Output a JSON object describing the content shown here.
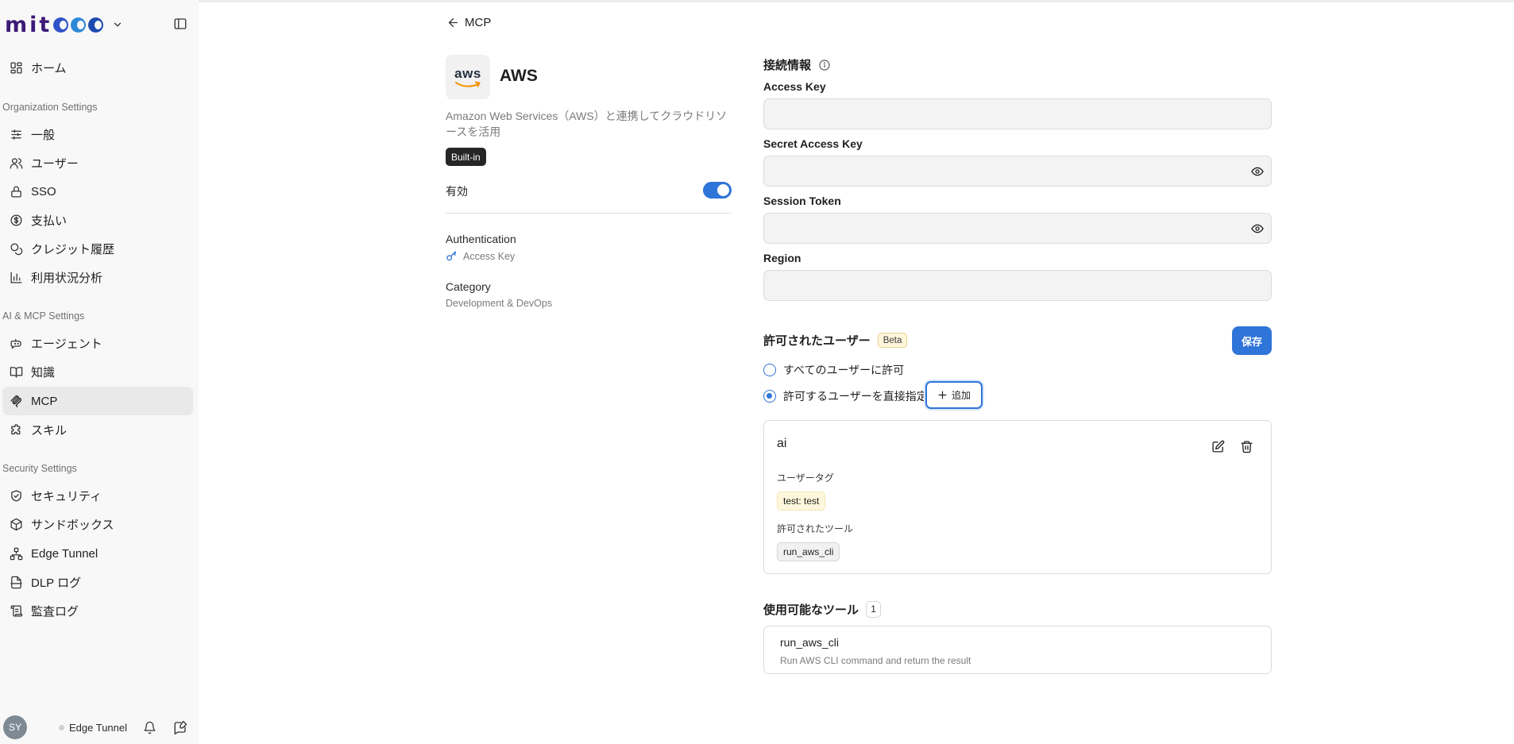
{
  "sidebar": {
    "logo_text": "mit",
    "sections": {
      "organization": "Organization Settings",
      "ai_mcp": "AI & MCP Settings",
      "security": "Security Settings"
    },
    "items": {
      "home": "ホーム",
      "general": "一般",
      "users": "ユーザー",
      "sso": "SSO",
      "payment": "支払い",
      "credit_history": "クレジット履歴",
      "usage_analysis": "利用状況分析",
      "agent": "エージェント",
      "knowledge": "知識",
      "mcp": "MCP",
      "skill": "スキル",
      "security": "セキュリティ",
      "sandbox": "サンドボックス",
      "edge_tunnel": "Edge Tunnel",
      "dlp_log": "DLP ログ",
      "audit_log": "監査ログ"
    },
    "active_item": "mcp",
    "footer": {
      "avatar_initials": "SY",
      "edge_tunnel_status": "Edge Tunnel"
    }
  },
  "header": {
    "back_label": "MCP"
  },
  "app": {
    "logo_word": "aws",
    "name": "AWS",
    "description": "Amazon Web Services（AWS）と連携してクラウドリソースを活用",
    "badge": "Built-in",
    "enabled_label": "有効",
    "enabled": true,
    "authentication_label": "Authentication",
    "authentication_value": "Access Key",
    "category_label": "Category",
    "category_value": "Development & DevOps"
  },
  "connection": {
    "title": "接続情報",
    "fields": {
      "access_key": {
        "label": "Access Key",
        "value": ""
      },
      "secret_access_key": {
        "label": "Secret Access Key",
        "value": ""
      },
      "session_token": {
        "label": "Session Token",
        "value": ""
      },
      "region": {
        "label": "Region",
        "value": ""
      }
    }
  },
  "permissions": {
    "title": "許可されたユーザー",
    "beta_label": "Beta",
    "save_label": "保存",
    "option_all": "すべてのユーザーに許可",
    "option_specific": "許可するユーザーを直接指定",
    "selected_option": "specific",
    "add_label": "追加",
    "user_card": {
      "name": "ai",
      "tags_label": "ユーザータグ",
      "tag": "test: test",
      "tools_label": "許可されたツール",
      "tool": "run_aws_cli"
    }
  },
  "available_tools": {
    "title": "使用可能なツール",
    "count": "1",
    "items": [
      {
        "name": "run_aws_cli",
        "description": "Run AWS CLI command and return the result"
      }
    ]
  },
  "colors": {
    "accent": "#2f74d8",
    "sidebar_bg": "#f8f8f8",
    "input_bg": "#f3f3f3"
  }
}
